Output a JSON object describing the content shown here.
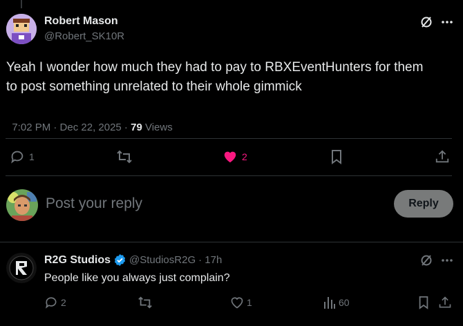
{
  "main_post": {
    "author_name": "Robert Mason",
    "author_handle": "@Robert_SK10R",
    "text_line1": "Yeah I wonder how much they had to pay to RBXEventHunters for them",
    "text_line2": "to post something unrelated to their whole gimmick",
    "timestamp": "7:02 PM · Dec 22, 2025 · ",
    "views_count": "79",
    "views_label": " Views",
    "reply_count": "1",
    "like_count": "2"
  },
  "composer": {
    "placeholder": "Post your reply",
    "reply_button": "Reply"
  },
  "reply_post": {
    "author_name": "R2G Studios",
    "author_handle": "@StudiosR2G",
    "time": "· 17h",
    "text": "People like you always just complain?",
    "reply_count": "2",
    "like_count": "1",
    "views_count": "60"
  },
  "icons": [
    "grok-icon",
    "more-icon",
    "reply-icon",
    "repost-icon",
    "like-icon",
    "bookmark-icon",
    "share-icon",
    "views-icon",
    "verified-badge-icon"
  ],
  "colors": {
    "background": "#000000",
    "text": "#e7e9ea",
    "muted": "#71767b",
    "like_active": "#f91880",
    "verified": "#1d9bf0",
    "divider": "#2f3336"
  }
}
